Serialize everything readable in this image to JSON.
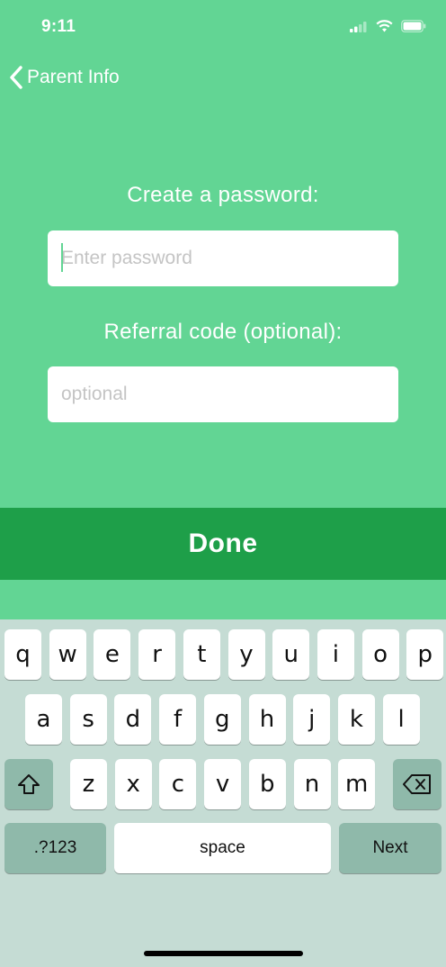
{
  "status_bar": {
    "time": "9:11"
  },
  "nav": {
    "back_label": "Parent Info"
  },
  "form": {
    "password_label": "Create a password:",
    "password_placeholder": "Enter password",
    "referral_label": "Referral code (optional):",
    "referral_placeholder": "optional"
  },
  "done_button": "Done",
  "keyboard": {
    "row1": [
      "q",
      "w",
      "e",
      "r",
      "t",
      "y",
      "u",
      "i",
      "o",
      "p"
    ],
    "row2": [
      "a",
      "s",
      "d",
      "f",
      "g",
      "h",
      "j",
      "k",
      "l"
    ],
    "row3": [
      "z",
      "x",
      "c",
      "v",
      "b",
      "n",
      "m"
    ],
    "numbers_key": ".?123",
    "space_key": "space",
    "next_key": "Next",
    "shift_icon": "shift-icon",
    "delete_icon": "delete-icon"
  },
  "colors": {
    "background": "#62d594",
    "done": "#1e9f49",
    "keyboard": "#c5dcd4"
  }
}
